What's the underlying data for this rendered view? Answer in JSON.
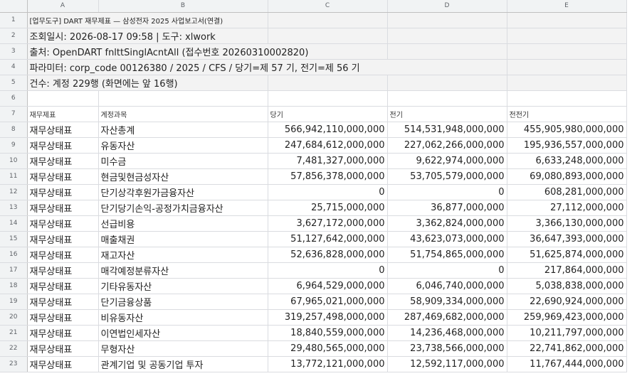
{
  "columns": [
    "A",
    "B",
    "C",
    "D",
    "E"
  ],
  "meta": {
    "title": "[업무도구] DART 재무제표 — 삼성전자 2025 사업보고서(연결)",
    "query_time": "조회일시: 2026-08-17 09:58  |  도구: xlwork",
    "source": "출처: OpenDART fnlttSinglAcntAll (접수번호 20260310002820)",
    "params": "파라미터: corp_code 00126380 / 2025 / CFS / 당기=제 57 기, 전기=제 56 기",
    "count": "건수: 계정 229행 (화면에는 앞 16행)"
  },
  "header": {
    "statement": "재무제표",
    "account": "계정과목",
    "current": "당기",
    "prior": "전기",
    "prior2": "전전기"
  },
  "rows": [
    {
      "n": "8",
      "s": "재무상태표",
      "a": "자산총계",
      "c": "566,942,110,000,000",
      "p": "514,531,948,000,000",
      "pp": "455,905,980,000,000"
    },
    {
      "n": "9",
      "s": "재무상태표",
      "a": "유동자산",
      "c": "247,684,612,000,000",
      "p": "227,062,266,000,000",
      "pp": "195,936,557,000,000"
    },
    {
      "n": "10",
      "s": "재무상태표",
      "a": "미수금",
      "c": "7,481,327,000,000",
      "p": "9,622,974,000,000",
      "pp": "6,633,248,000,000"
    },
    {
      "n": "11",
      "s": "재무상태표",
      "a": "현금및현금성자산",
      "c": "57,856,378,000,000",
      "p": "53,705,579,000,000",
      "pp": "69,080,893,000,000"
    },
    {
      "n": "12",
      "s": "재무상태표",
      "a": "단기상각후원가금융자산",
      "c": "0",
      "p": "0",
      "pp": "608,281,000,000"
    },
    {
      "n": "13",
      "s": "재무상태표",
      "a": "단기당기손익-공정가치금융자산",
      "c": "25,715,000,000",
      "p": "36,877,000,000",
      "pp": "27,112,000,000"
    },
    {
      "n": "14",
      "s": "재무상태표",
      "a": "선급비용",
      "c": "3,627,172,000,000",
      "p": "3,362,824,000,000",
      "pp": "3,366,130,000,000"
    },
    {
      "n": "15",
      "s": "재무상태표",
      "a": "매출채권",
      "c": "51,127,642,000,000",
      "p": "43,623,073,000,000",
      "pp": "36,647,393,000,000"
    },
    {
      "n": "16",
      "s": "재무상태표",
      "a": "재고자산",
      "c": "52,636,828,000,000",
      "p": "51,754,865,000,000",
      "pp": "51,625,874,000,000"
    },
    {
      "n": "17",
      "s": "재무상태표",
      "a": "매각예정분류자산",
      "c": "0",
      "p": "0",
      "pp": "217,864,000,000"
    },
    {
      "n": "18",
      "s": "재무상태표",
      "a": "기타유동자산",
      "c": "6,964,529,000,000",
      "p": "6,046,740,000,000",
      "pp": "5,038,838,000,000"
    },
    {
      "n": "19",
      "s": "재무상태표",
      "a": "단기금융상품",
      "c": "67,965,021,000,000",
      "p": "58,909,334,000,000",
      "pp": "22,690,924,000,000"
    },
    {
      "n": "20",
      "s": "재무상태표",
      "a": "비유동자산",
      "c": "319,257,498,000,000",
      "p": "287,469,682,000,000",
      "pp": "259,969,423,000,000"
    },
    {
      "n": "21",
      "s": "재무상태표",
      "a": "이연법인세자산",
      "c": "18,840,559,000,000",
      "p": "14,236,468,000,000",
      "pp": "10,211,797,000,000"
    },
    {
      "n": "22",
      "s": "재무상태표",
      "a": "무형자산",
      "c": "29,480,565,000,000",
      "p": "23,738,566,000,000",
      "pp": "22,741,862,000,000"
    },
    {
      "n": "23",
      "s": "재무상태표",
      "a": "관계기업 및 공동기업 투자",
      "c": "13,772,121,000,000",
      "p": "12,592,117,000,000",
      "pp": "11,767,444,000,000"
    }
  ]
}
